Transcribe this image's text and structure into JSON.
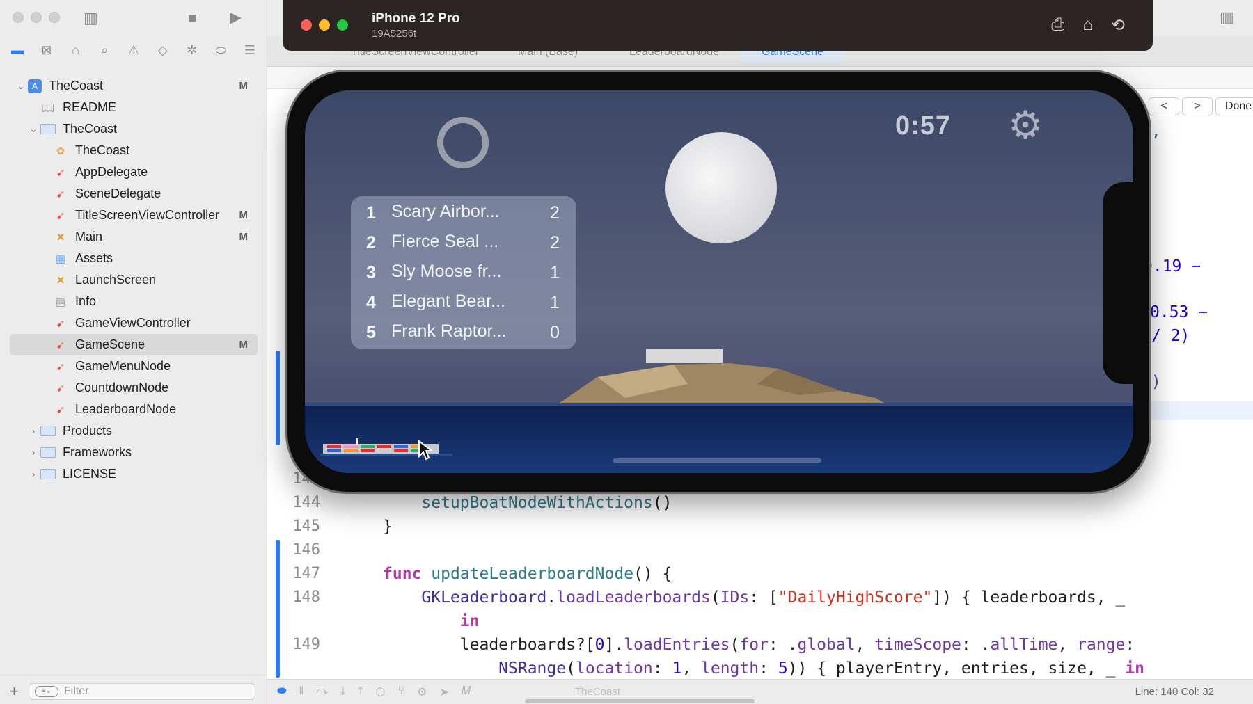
{
  "navigator": {
    "tree": [
      {
        "label": "TheCoast",
        "badge": "M",
        "kind": "project",
        "indent": 0,
        "disclosure": "open"
      },
      {
        "label": "README",
        "badge": "",
        "kind": "doc",
        "indent": 1,
        "disclosure": ""
      },
      {
        "label": "TheCoast",
        "badge": "",
        "kind": "folder",
        "indent": 1,
        "disclosure": "open"
      },
      {
        "label": "TheCoast",
        "badge": "",
        "kind": "entitlements",
        "indent": 2,
        "disclosure": ""
      },
      {
        "label": "AppDelegate",
        "badge": "",
        "kind": "swift",
        "indent": 2,
        "disclosure": ""
      },
      {
        "label": "SceneDelegate",
        "badge": "",
        "kind": "swift",
        "indent": 2,
        "disclosure": ""
      },
      {
        "label": "TitleScreenViewController",
        "badge": "M",
        "kind": "swift",
        "indent": 2,
        "disclosure": ""
      },
      {
        "label": "Main",
        "badge": "M",
        "kind": "storyboard",
        "indent": 2,
        "disclosure": ""
      },
      {
        "label": "Assets",
        "badge": "",
        "kind": "assets",
        "indent": 2,
        "disclosure": ""
      },
      {
        "label": "LaunchScreen",
        "badge": "",
        "kind": "storyboard",
        "indent": 2,
        "disclosure": ""
      },
      {
        "label": "Info",
        "badge": "",
        "kind": "plist",
        "indent": 2,
        "disclosure": ""
      },
      {
        "label": "GameViewController",
        "badge": "",
        "kind": "swift",
        "indent": 2,
        "disclosure": ""
      },
      {
        "label": "GameScene",
        "badge": "M",
        "kind": "swift",
        "indent": 2,
        "disclosure": "",
        "selected": true
      },
      {
        "label": "GameMenuNode",
        "badge": "",
        "kind": "swift",
        "indent": 2,
        "disclosure": ""
      },
      {
        "label": "CountdownNode",
        "badge": "",
        "kind": "swift",
        "indent": 2,
        "disclosure": ""
      },
      {
        "label": "LeaderboardNode",
        "badge": "",
        "kind": "swift",
        "indent": 2,
        "disclosure": ""
      },
      {
        "label": "Products",
        "badge": "",
        "kind": "folder",
        "indent": 1,
        "disclosure": "closed"
      },
      {
        "label": "Frameworks",
        "badge": "",
        "kind": "folder",
        "indent": 1,
        "disclosure": "closed"
      },
      {
        "label": "LICENSE",
        "badge": "",
        "kind": "folder-blue",
        "indent": 1,
        "disclosure": "closed"
      }
    ],
    "filter_placeholder": "Filter"
  },
  "editor": {
    "tabs": [
      "TitleScreenViewController",
      "Main (Base)",
      "LeaderboardNode",
      "GameScene"
    ],
    "active_tab": "GameScene",
    "done_label": "Done",
    "prev_label": "<",
    "next_label": ">",
    "partial_lines": [
      {
        "text": "s,",
        "cls": "fn"
      },
      {
        "text": "0.19 −",
        "cls": "num"
      },
      {
        "text": "0.53 −",
        "cls": "num"
      },
      {
        "text": "/ 2)",
        "cls": "num"
      },
      {
        "text": "e)",
        "cls": "prop"
      }
    ],
    "code_lines": [
      {
        "no": "143",
        "html": ""
      },
      {
        "no": "144",
        "html": "    <span class=\"fn\">setupBoatNodeWithActions</span>()"
      },
      {
        "no": "145",
        "html": "}"
      },
      {
        "no": "146",
        "html": ""
      },
      {
        "no": "147",
        "html": "<span class=\"kw\">func</span> <span class=\"fn\">updateLeaderboardNode</span>() {"
      },
      {
        "no": "148",
        "html": "    <span class=\"ty\">GKLeaderboard</span>.<span class=\"prop\">loadLeaderboards</span>(<span class=\"prop\">IDs</span>: [<span class=\"str\">\"DailyHighScore\"</span>]) { leaderboards, _"
      },
      {
        "no": "",
        "html": "        <span class=\"kw\">in</span>"
      },
      {
        "no": "149",
        "html": "        leaderboards?[<span class=\"num\">0</span>].<span class=\"prop\">loadEntries</span>(<span class=\"prop\">for</span>: .<span class=\"prop\">global</span>, <span class=\"prop\">timeScope</span>: .<span class=\"prop\">allTime</span>, <span class=\"prop\">range</span>:"
      },
      {
        "no": "",
        "html": "            <span class=\"ty\">NSRange</span>(<span class=\"prop\">location</span>: <span class=\"num\">1</span>, <span class=\"prop\">length</span>: <span class=\"num\">5</span>)) { playerEntry, entries, size, _ <span class=\"kw\">in</span>"
      }
    ],
    "status": {
      "scheme": "TheCoast",
      "line_col": "Line: 140  Col: 32"
    }
  },
  "simulator": {
    "device": "iPhone 12 Pro",
    "build": "19A5256t",
    "game": {
      "timer": "0:57",
      "leaderboard": [
        {
          "rank": "1",
          "name": "Scary Airbor...",
          "score": "2"
        },
        {
          "rank": "2",
          "name": "Fierce Seal ...",
          "score": "2"
        },
        {
          "rank": "3",
          "name": "Sly Moose fr...",
          "score": "1"
        },
        {
          "rank": "4",
          "name": "Elegant Bear...",
          "score": "1"
        },
        {
          "rank": "5",
          "name": "Frank Raptor...",
          "score": "0"
        }
      ]
    }
  },
  "colors": {
    "accent": "#2a7ff5",
    "traffic_red": "#fe5f57",
    "traffic_yellow": "#febc2e",
    "traffic_green": "#28c840",
    "swift_orange": "#f05138"
  }
}
